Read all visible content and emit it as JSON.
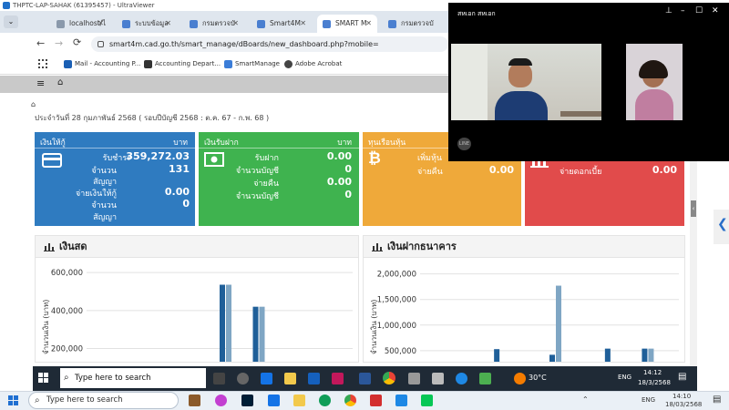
{
  "uv_title": "THPTC-LAP-SAHAK (61395457) - UltraViewer",
  "tabs": [
    {
      "label": "localhost/ไ",
      "active": false
    },
    {
      "label": "ระบบข้อมูล",
      "active": false
    },
    {
      "label": "กรมตรวจบั",
      "active": false
    },
    {
      "label": "Smart4M",
      "active": false
    },
    {
      "label": "SMART M",
      "active": true
    },
    {
      "label": "กรมตรวจบั",
      "active": false
    },
    {
      "label": "กรมตรวจบั",
      "active": false
    }
  ],
  "url": "smart4m.cad.go.th/smart_manage/dBoards/new_dashboard.php?mobile=",
  "bookmarks": [
    {
      "label": "Mail - Accounting P...",
      "color": "#1a5fb4"
    },
    {
      "label": "Accounting Depart...",
      "color": "#333333"
    },
    {
      "label": "SmartManage",
      "color": "#3b7dd8"
    },
    {
      "label": "Adobe Acrobat",
      "color": "#444444"
    }
  ],
  "date_text": "ประจำวันที่ 28 กุมภาพันธ์ 2568 ( รอบปีบัญชี 2568 : ต.ค. 67 - ก.พ. 68 )",
  "cards": {
    "loan": {
      "title": "เงินให้กู้",
      "unit": "บาท",
      "color": "#2f7bc0",
      "rows": [
        {
          "label": "รับชำระ",
          "value": "359,272.03"
        },
        {
          "label": "จำนวน",
          "value": "131"
        },
        {
          "label": "สัญญา",
          "value": ""
        },
        {
          "label": "จ่ายเงินให้กู้",
          "value": "0.00"
        },
        {
          "label": "จำนวน",
          "value": "0"
        },
        {
          "label": "สัญญา",
          "value": ""
        }
      ]
    },
    "deposit": {
      "title": "เงินรับฝาก",
      "unit": "บาท",
      "color": "#3fb34f",
      "rows": [
        {
          "label": "รับฝาก",
          "value": "0.00"
        },
        {
          "label": "จำนวนบัญชี",
          "value": "0"
        },
        {
          "label": "จ่ายคืน",
          "value": "0.00"
        },
        {
          "label": "จำนวนบัญชี",
          "value": "0"
        }
      ]
    },
    "shares": {
      "title": "ทุนเรือนหุ้น",
      "color": "#efa93a",
      "rows": [
        {
          "label": "เพิ่มหุ้น",
          "value": ""
        },
        {
          "label": "จ่ายคืน",
          "value": "0.00"
        }
      ]
    },
    "dividend": {
      "color": "#e14b4b",
      "rows": [
        {
          "label": "จ่ายดอกเบี้ย",
          "value": "0.00"
        }
      ]
    }
  },
  "video": {
    "caller": "สหเอก สหเอก"
  },
  "chart_data": [
    {
      "type": "bar",
      "title": "เงินสด",
      "ylabel": "จำนวนเงิน (บาท)",
      "ylim": [
        140000,
        620000
      ],
      "yticks": [
        "600,000",
        "400,000",
        "200,000"
      ],
      "ytick_values": [
        600000,
        400000,
        200000
      ],
      "groups": [
        {
          "slot": 8,
          "values": [
            536000,
            536000
          ]
        },
        {
          "slot": 10,
          "values": [
            420000,
            420000
          ]
        }
      ],
      "slots": 16,
      "series_colors": [
        "#1f5f99",
        "#7fa6c4"
      ]
    },
    {
      "type": "bar",
      "title": "เงินฝากธนาคาร",
      "ylabel": "จำนวนเงิน (บาท)",
      "ylim": [
        320000,
        2100000
      ],
      "yticks": [
        "2,000,000",
        "1,500,000",
        "1,000,000",
        "500,000"
      ],
      "ytick_values": [
        2000000,
        1500000,
        1000000,
        500000
      ],
      "groups": [
        {
          "slot": 4,
          "values": [
            530000,
            0
          ]
        },
        {
          "slot": 7,
          "values": [
            420000,
            1770000
          ]
        },
        {
          "slot": 10,
          "values": [
            540000,
            0
          ]
        },
        {
          "slot": 12,
          "values": [
            540000,
            540000
          ]
        }
      ],
      "slots": 14,
      "series_colors": [
        "#1f5f99",
        "#7fa6c4"
      ]
    }
  ],
  "taskbar_inner": {
    "search": "Type here to search",
    "weather": "30°C",
    "lang": "ENG",
    "time": "14:12",
    "date": "18/3/2568"
  },
  "taskbar_outer": {
    "search": "Type here to search",
    "lang": "ENG",
    "time": "14:10",
    "date": "18/03/2568"
  }
}
